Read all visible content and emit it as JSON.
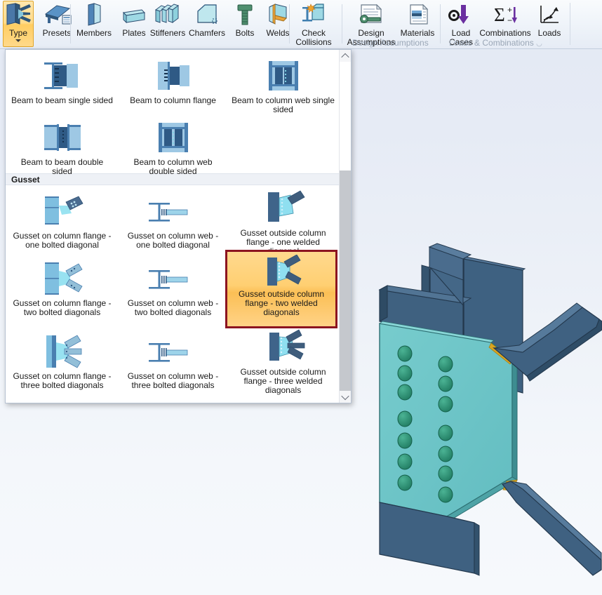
{
  "app": {
    "viewport_bg_top": "#e3e9f4",
    "viewport_bg_bottom": "#f6f9fc",
    "accent_selected_fill": "#ffcf72",
    "accent_selected_border": "#8c1420",
    "highlight_button_fill": "#ffd98a"
  },
  "ribbon": {
    "buttons": [
      {
        "id": "type",
        "label": "Type",
        "icon": "connection-type-icon",
        "has_caret": true,
        "state": "active"
      },
      {
        "id": "presets",
        "label": "Presets",
        "icon": "presets-icon",
        "has_caret": false,
        "state": "normal"
      },
      {
        "id": "members",
        "label": "Members",
        "icon": "members-icon",
        "has_caret": false,
        "state": "normal"
      },
      {
        "id": "plates",
        "label": "Plates",
        "icon": "plates-icon",
        "has_caret": false,
        "state": "normal"
      },
      {
        "id": "stiffeners",
        "label": "Stiffeners",
        "icon": "stiffeners-icon",
        "has_caret": false,
        "state": "normal"
      },
      {
        "id": "chamfers",
        "label": "Chamfers",
        "icon": "chamfers-icon",
        "has_caret": false,
        "state": "normal"
      },
      {
        "id": "bolts",
        "label": "Bolts",
        "icon": "bolt-icon",
        "has_caret": false,
        "state": "normal"
      },
      {
        "id": "welds",
        "label": "Welds",
        "icon": "weld-icon",
        "has_caret": false,
        "state": "normal"
      },
      {
        "id": "check-collisions",
        "label": "Check\nCollisions",
        "icon": "check-collisions-icon",
        "has_caret": false,
        "state": "normal"
      },
      {
        "id": "design-assumptions",
        "label": "Design\nAssumptions",
        "icon": "design-assumptions-icon",
        "has_caret": false,
        "state": "normal"
      },
      {
        "id": "materials",
        "label": "Materials",
        "icon": "materials-icon",
        "has_caret": false,
        "state": "normal"
      },
      {
        "id": "load-cases",
        "label": "Load\nCases",
        "icon": "load-cases-icon",
        "has_caret": false,
        "state": "normal"
      },
      {
        "id": "combinations",
        "label": "Combinations",
        "icon": "combinations-icon",
        "has_caret": false,
        "state": "normal"
      },
      {
        "id": "loads",
        "label": "Loads",
        "icon": "loads-icon",
        "has_caret": false,
        "state": "normal"
      }
    ],
    "labels": {
      "type": "Type",
      "presets": "Presets",
      "members": "Members",
      "plates": "Plates",
      "stiffeners": "Stiffeners",
      "chamfers": "Chamfers",
      "bolts": "Bolts",
      "welds": "Welds",
      "check_collisions_l1": "Check",
      "check_collisions_l2": "Collisions",
      "design_assumptions_l1": "Design",
      "design_assumptions_l2": "Assumptions",
      "materials": "Materials",
      "load_cases_l1": "Load",
      "load_cases_l2": "Cases",
      "combinations": "Combinations",
      "loads": "Loads"
    },
    "group_footers": [
      {
        "id": "design-assumptions-group",
        "label": "Design Assumptions",
        "has_launcher": false
      },
      {
        "id": "loads-combinations-group",
        "label": "Loads & Combinations",
        "has_launcher": true
      }
    ]
  },
  "gallery": {
    "scrollbar": {
      "up_icon": "chevron-up-icon",
      "down_icon": "chevron-down-icon"
    },
    "sections": [
      {
        "id": "shear",
        "header": null,
        "items": [
          {
            "id": "beam-to-beam-single-sided",
            "label": "Beam to beam single sided",
            "icon": "beam-to-beam-single-sided-icon",
            "selected": false
          },
          {
            "id": "beam-to-column-flange",
            "label": "Beam to column flange",
            "icon": "beam-to-column-flange-icon",
            "selected": false
          },
          {
            "id": "beam-to-column-web-single-sided",
            "label": "Beam to column web single sided",
            "icon": "beam-to-column-web-single-sided-icon",
            "selected": false
          },
          {
            "id": "beam-to-beam-double-sided",
            "label": "Beam to beam double sided",
            "icon": "beam-to-beam-double-sided-icon",
            "selected": false
          },
          {
            "id": "beam-to-column-web-double-sided",
            "label": "Beam to column web double sided",
            "icon": "beam-to-column-web-double-sided-icon",
            "selected": false
          }
        ]
      },
      {
        "id": "gusset",
        "header": "Gusset",
        "items": [
          {
            "id": "gusset-col-flange-one-bolted",
            "label": "Gusset on column flange - one bolted diagonal",
            "icon": "gusset-column-flange-one-bolted-icon",
            "selected": false
          },
          {
            "id": "gusset-col-web-one-bolted",
            "label": "Gusset on column web - one bolted diagonal",
            "icon": "gusset-column-web-one-bolted-icon",
            "selected": false
          },
          {
            "id": "gusset-outside-flange-one-welded",
            "label": "Gusset outside column flange - one welded diagonal",
            "icon": "gusset-outside-flange-one-welded-icon",
            "selected": false
          },
          {
            "id": "gusset-col-flange-two-bolted",
            "label": "Gusset on column flange - two bolted diagonals",
            "icon": "gusset-column-flange-two-bolted-icon",
            "selected": false
          },
          {
            "id": "gusset-col-web-two-bolted",
            "label": "Gusset on column web - two bolted diagonals",
            "icon": "gusset-column-web-two-bolted-icon",
            "selected": false
          },
          {
            "id": "gusset-outside-flange-two-welded",
            "label": "Gusset outside column flange - two welded diagonals",
            "icon": "gusset-outside-flange-two-welded-icon",
            "selected": true
          },
          {
            "id": "gusset-col-flange-three-bolted",
            "label": "Gusset on column flange - three bolted diagonals",
            "icon": "gusset-column-flange-three-bolted-icon",
            "selected": false
          },
          {
            "id": "gusset-col-web-three-bolted",
            "label": "Gusset on column web - three bolted diagonals",
            "icon": "gusset-column-web-three-bolted-icon",
            "selected": false
          },
          {
            "id": "gusset-outside-flange-three-welded",
            "label": "Gusset outside column flange - three welded diagonals",
            "icon": "gusset-outside-flange-three-welded-icon",
            "selected": false
          }
        ]
      }
    ],
    "item_labels": {
      "i0": "Beam to beam single sided",
      "i1": "Beam to column flange",
      "i2": "Beam to column web single sided",
      "i3": "Beam to beam double sided",
      "i4": "Beam to column web double sided",
      "sec_gusset": "Gusset",
      "g0": "Gusset on column flange - one bolted diagonal",
      "g1": "Gusset on column web - one bolted diagonal",
      "g2": "Gusset outside column flange - one welded diagonal",
      "g3": "Gusset on column flange - two bolted diagonals",
      "g4": "Gusset on column web - two bolted diagonals",
      "g5": "Gusset outside column flange - two welded diagonals",
      "g6": "Gusset on column flange - three bolted diagonals",
      "g7": "Gusset on column web - three bolted diagonals",
      "g8": "Gusset outside column flange - three welded diagonals"
    }
  },
  "model": {
    "name": "gusset-connection-3d-model",
    "colors": {
      "gusset_plate": "#6cc5c8",
      "steel_dark": "#3f5d79",
      "steel_mid": "#4a6c8c",
      "bolt": "#2f8f75",
      "weld": "#d8a01f"
    },
    "bolt_count": 14,
    "diagonal_count": 2
  }
}
